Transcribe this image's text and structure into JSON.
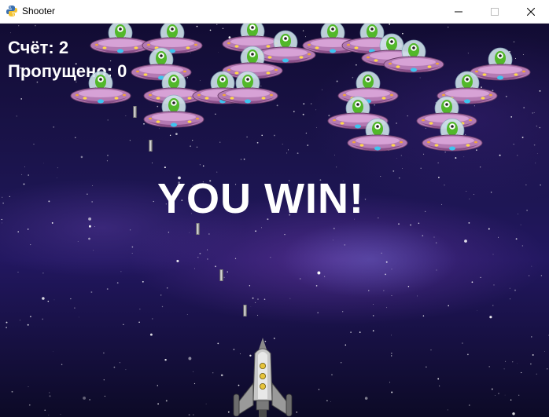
{
  "window": {
    "title": "Shooter",
    "icons": {
      "app": "python-icon",
      "minimize": "minimize-icon",
      "maximize": "maximize-icon",
      "close": "close-icon"
    }
  },
  "hud": {
    "score_text": "Счёт: 2",
    "missed_text": "Пропущено: 0"
  },
  "message": "YOU WIN!",
  "sprites": {
    "enemy": "alien-ufo",
    "bullet": "bullet",
    "player": "rocket"
  },
  "colors": {
    "hud_text": "#ffffff",
    "ufo_saucer": "#b47ab3",
    "alien": "#52b82a"
  }
}
